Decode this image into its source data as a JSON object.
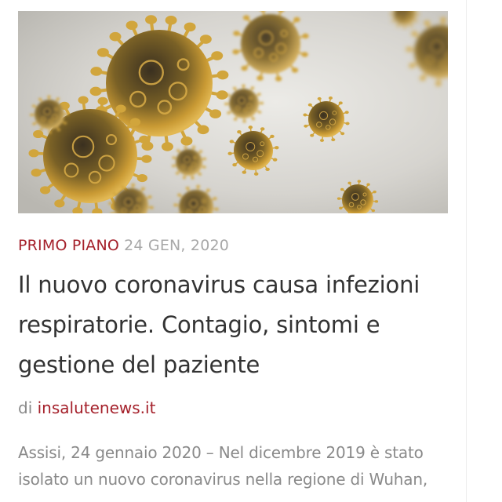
{
  "article": {
    "category": "PRIMO PIANO",
    "date": "24 GEN, 2020",
    "title": "Il nuovo coronavirus causa infezioni respiratorie. Contagio, sintomi e gestione del paziente",
    "byline_prefix": "di",
    "source": "insalutenews.it",
    "excerpt": "Assisi, 24 gennaio 2020 – Nel dicembre 2019 è stato isolato un nuovo coronavirus nella regione di Wuhan,"
  },
  "image": {
    "subject": "coronavirus-illustration",
    "background_color": "#d9d7d2",
    "virus_color": "#d1a53c",
    "virus_dark_color": "#2a2418"
  },
  "colors": {
    "accent": "#a5212b",
    "title": "#333333",
    "muted": "#a8a8a8",
    "body": "#8a8a8a"
  }
}
